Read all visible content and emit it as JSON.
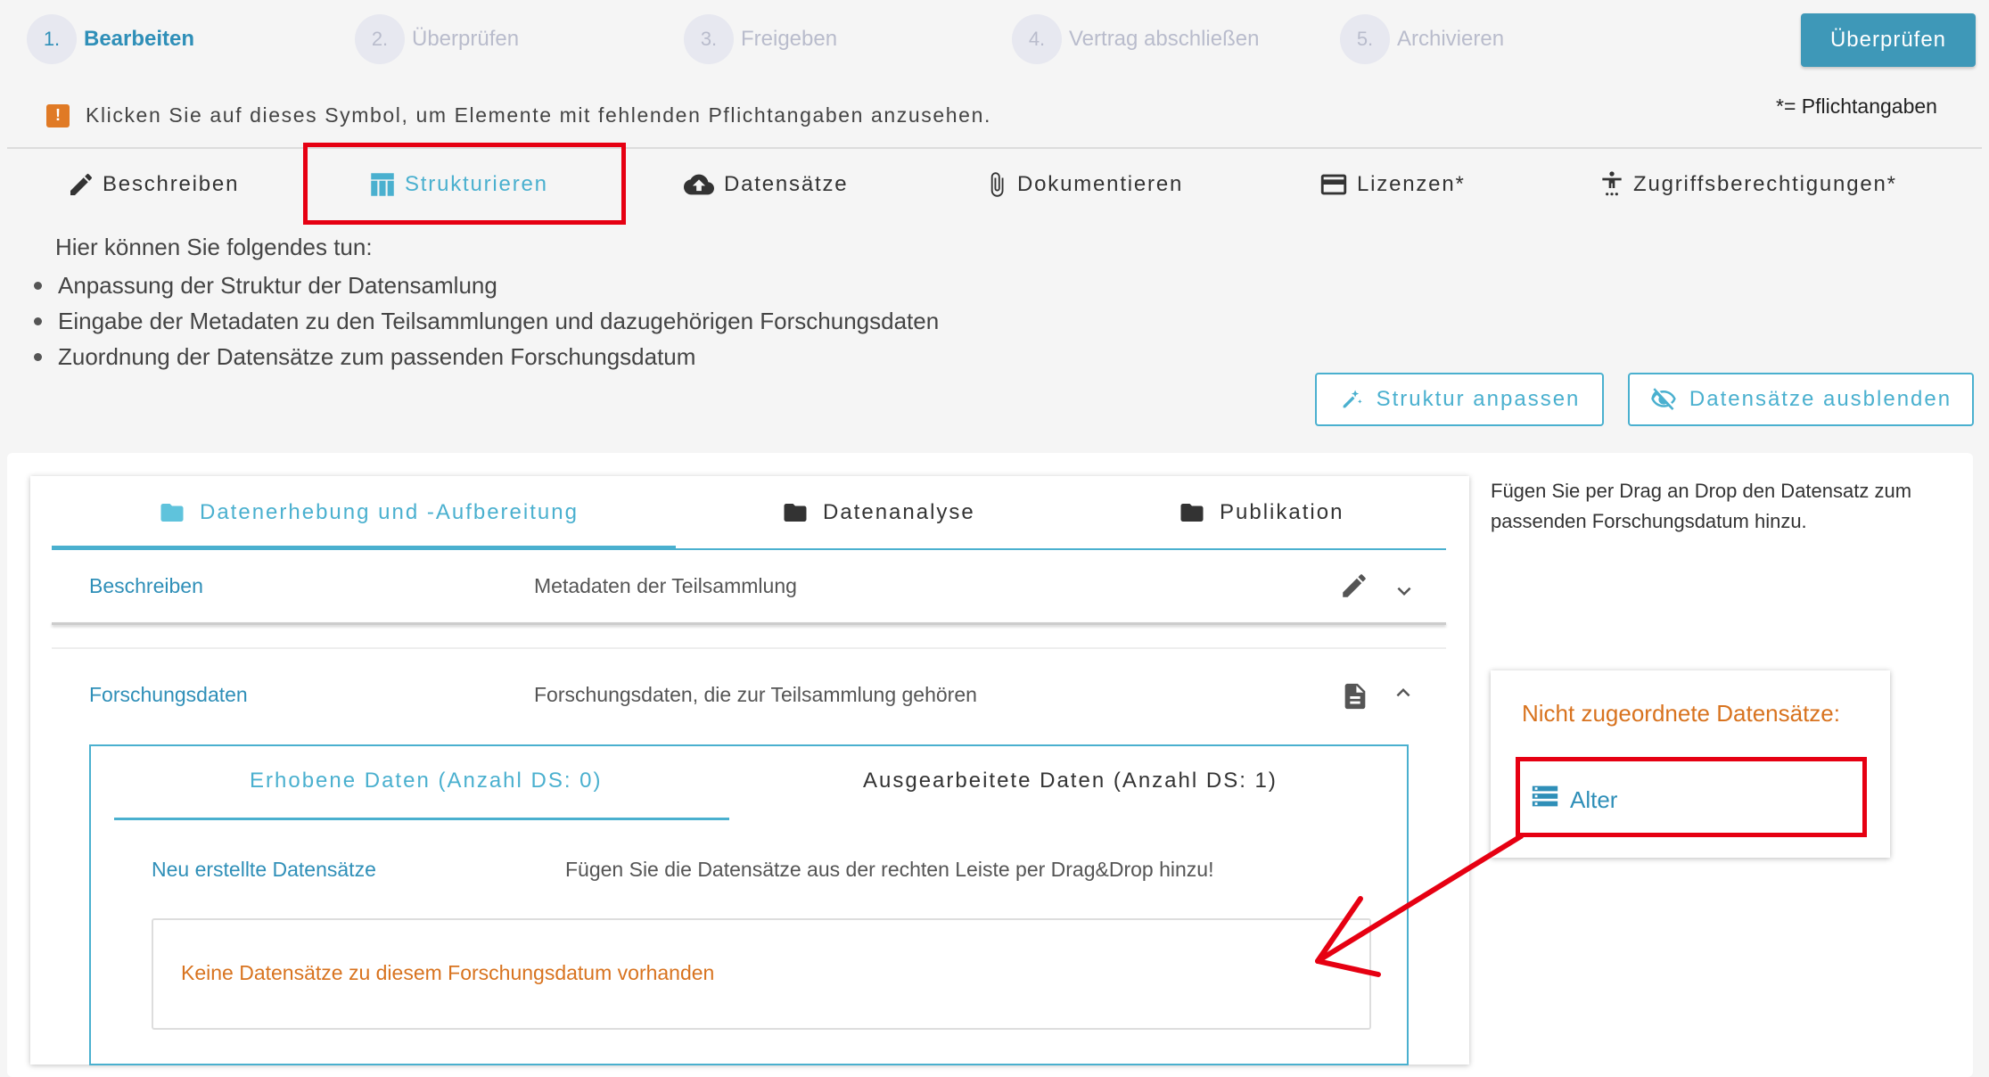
{
  "stepper": {
    "steps": [
      {
        "number": "1.",
        "label": "Bearbeiten"
      },
      {
        "number": "2.",
        "label": "Überprüfen"
      },
      {
        "number": "3.",
        "label": "Freigeben"
      },
      {
        "number": "4.",
        "label": "Vertrag abschließen"
      },
      {
        "number": "5.",
        "label": "Archivieren"
      }
    ],
    "active_step": 1,
    "primary_button": "Überprüfen"
  },
  "notice": {
    "icon": "warning-icon",
    "text": "Klicken Sie auf dieses Symbol, um Elemente mit fehlenden Pflichtangaben anzusehen.",
    "required_hint": "*= Pflichtangaben"
  },
  "tabs": [
    {
      "label": "Beschreiben",
      "icon": "pencil-icon"
    },
    {
      "label": "Strukturieren",
      "icon": "table-icon",
      "selected": true
    },
    {
      "label": "Datensätze",
      "icon": "cloud-upload-icon"
    },
    {
      "label": "Dokumentieren",
      "icon": "paperclip-icon"
    },
    {
      "label": "Lizenzen*",
      "icon": "credit-card-icon"
    },
    {
      "label": "Zugriffsberechtigungen*",
      "icon": "accessibility-icon"
    }
  ],
  "intro": {
    "heading": "Hier können Sie folgendes tun:",
    "bullets": [
      "Anpassung der Struktur der Datensamlung",
      "Eingabe der Metadaten zu den Teilsammlungen und dazugehörigen Forschungsdaten",
      "Zuordnung der Datensätze zum passenden Forschungsdatum"
    ]
  },
  "actions": {
    "adjust_structure": "Struktur anpassen",
    "hide_datasets": "Datensätze ausblenden"
  },
  "collection_tabs": [
    {
      "label": "Datenerhebung und -Aufbereitung",
      "selected": true
    },
    {
      "label": "Datenanalyse"
    },
    {
      "label": "Publikation"
    }
  ],
  "rows": {
    "describe": {
      "label": "Beschreiben",
      "description": "Metadaten der Teilsammlung"
    },
    "research": {
      "label": "Forschungsdaten",
      "description": "Forschungsdaten, die zur Teilsammlung gehören"
    }
  },
  "data_tabs": [
    {
      "label": "Erhobene Daten (Anzahl DS: 0)",
      "selected": true
    },
    {
      "label": "Ausgearbeitete Daten (Anzahl DS: 1)"
    }
  ],
  "new_datasets": {
    "label": "Neu erstellte Datensätze",
    "hint": "Fügen Sie die Datensätze aus der rechten Leiste per Drag&Drop hinzu!",
    "empty": "Keine Datensätze zu diesem Forschungsdatum vorhanden"
  },
  "sidebar": {
    "instruction": "Fügen Sie per Drag an Drop den Datensatz zum passenden Forschungsdatum hinzu.",
    "unassigned_title": "Nicht zugeordnete Datensätze:",
    "datasets": [
      {
        "label": "Alter",
        "icon": "storage-icon"
      }
    ]
  },
  "colors": {
    "accent": "#4ab0cf",
    "primary": "#3e98b8",
    "warning": "#d8731f",
    "highlight": "#e60012"
  }
}
